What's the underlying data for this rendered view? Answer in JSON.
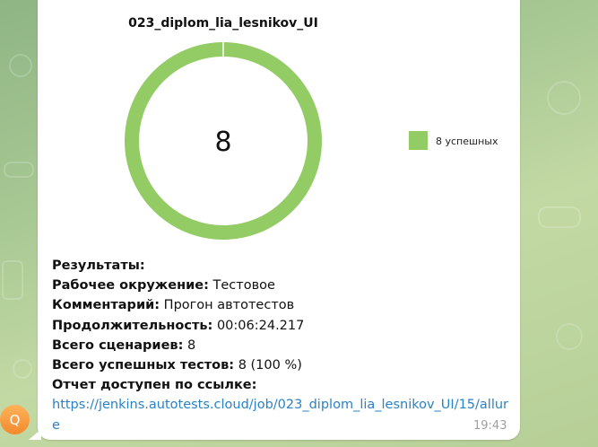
{
  "message": {
    "avatar_letter": "Q",
    "time": "19:43",
    "results_heading": "Результаты:",
    "environment_label": "Рабочее окружение:",
    "environment_value": "Тестовое",
    "comment_label": "Комментарий:",
    "comment_value": "Прогон автотестов",
    "duration_label": "Продолжительность:",
    "duration_value": "00:06:24.217",
    "total_label": "Всего сценариев:",
    "total_value": "8",
    "passed_label": "Всего успешных тестов:",
    "passed_value": "8 (100 %)",
    "report_label": "Отчет доступен по ссылке:",
    "report_link": "https://jenkins.autotests.cloud/job/023_diplom_lia_lesnikov_UI/15/allure"
  },
  "colors": {
    "success": "#93cb65",
    "link": "#2a82c6",
    "avatar": "#f59a3c"
  },
  "chart_data": {
    "type": "pie",
    "title": "023_diplom_lia_lesnikov_UI",
    "center_label": "8",
    "slices": [
      {
        "label": "8 успешных",
        "value": 8,
        "color": "#93cb65"
      }
    ],
    "legend_position": "right"
  }
}
